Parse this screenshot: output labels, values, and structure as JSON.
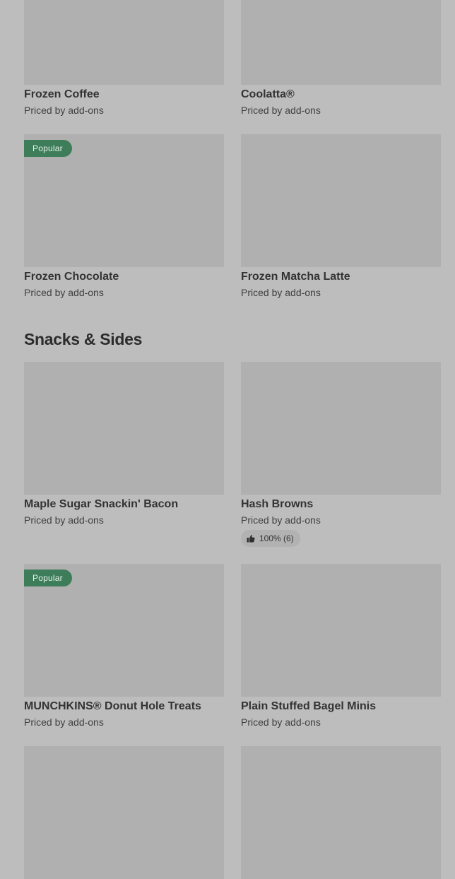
{
  "popular_badge": "Popular",
  "frozen_drinks": {
    "items": [
      {
        "title": "Frozen Coffee",
        "price": "Priced by add-ons"
      },
      {
        "title": "Coolatta®",
        "price": "Priced by add-ons"
      },
      {
        "title": "Frozen Chocolate",
        "price": "Priced by add-ons",
        "badge": "Popular"
      },
      {
        "title": "Frozen Matcha Latte",
        "price": "Priced by add-ons"
      }
    ]
  },
  "snacks_sides": {
    "heading": "Snacks & Sides",
    "items": [
      {
        "title": "Maple Sugar Snackin' Bacon",
        "price": "Priced by add-ons"
      },
      {
        "title": "Hash Browns",
        "price": "Priced by add-ons",
        "rating": "100% (6)"
      },
      {
        "title": "MUNCHKINS® Donut Hole Treats",
        "price": "Priced by add-ons",
        "badge": "Popular"
      },
      {
        "title": "Plain Stuffed Bagel Minis",
        "price": "Priced by add-ons"
      }
    ]
  },
  "icons": {
    "rating": "thumbs-up-icon"
  }
}
